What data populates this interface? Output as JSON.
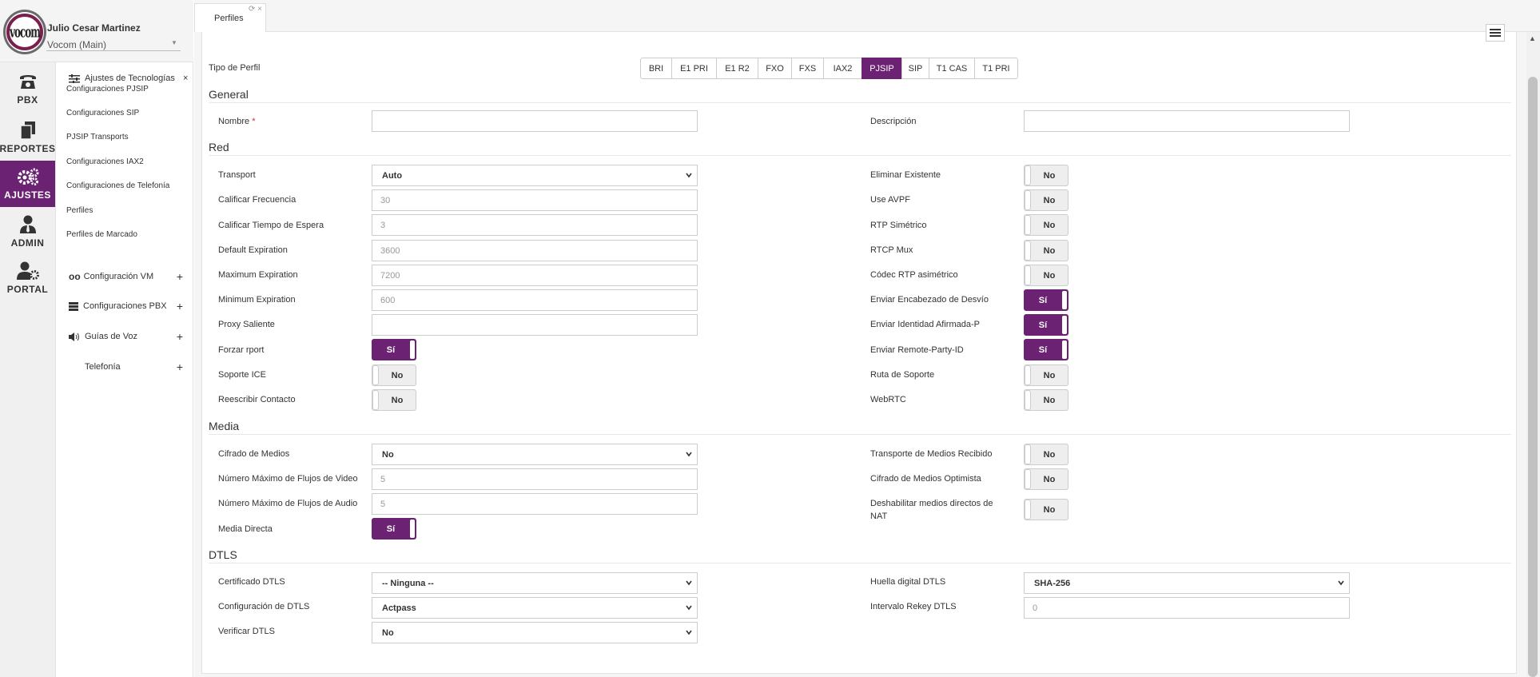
{
  "user": {
    "name": "Julio Cesar Martinez",
    "company": "Vocom (Main)",
    "logo_text": "vocom"
  },
  "rail": [
    {
      "label": "PBX",
      "icon": "phone-icon"
    },
    {
      "label": "REPORTES",
      "icon": "copy-icon"
    },
    {
      "label": "AJUSTES",
      "icon": "gears-icon",
      "active": true
    },
    {
      "label": "ADMIN",
      "icon": "user-tie-icon"
    },
    {
      "label": "PORTAL",
      "icon": "user-gear-icon"
    }
  ],
  "submenu": {
    "header": "Ajustes de Tecnologías",
    "close": "×",
    "links": [
      "Configuraciones PJSIP",
      "Configuraciones SIP",
      "PJSIP Transports",
      "Configuraciones IAX2",
      "Configuraciones de Telefonía",
      "Perfiles",
      "Perfiles de Marcado"
    ],
    "groups": [
      {
        "label": "Configuración VM",
        "icon": "voicemail-icon"
      },
      {
        "label": "Configuraciones PBX",
        "icon": "server-icon"
      },
      {
        "label": "Guías de Voz",
        "icon": "volume-icon"
      },
      {
        "label": "Telefonía",
        "icon": ""
      }
    ],
    "plus": "+"
  },
  "tab": {
    "label": "Perfiles",
    "icons": "⟳ ×"
  },
  "profile_type": {
    "label": "Tipo de Perfil",
    "options": [
      "BRI",
      "E1 PRI",
      "E1 R2",
      "FXO",
      "FXS",
      "IAX2",
      "PJSIP",
      "SIP",
      "T1 CAS",
      "T1 PRI"
    ],
    "selected": "PJSIP"
  },
  "sections": {
    "general": "General",
    "red": "Red",
    "media": "Media",
    "dtls": "DTLS"
  },
  "general": {
    "nombre_label": "Nombre",
    "required_mark": "*",
    "nombre_value": "",
    "descripcion_label": "Descripción",
    "descripcion_value": ""
  },
  "red": {
    "left": [
      {
        "label": "Transport",
        "type": "select",
        "value": "Auto"
      },
      {
        "label": "Calificar Frecuencia",
        "type": "input",
        "value": "30"
      },
      {
        "label": "Calificar Tiempo de Espera",
        "type": "input",
        "value": "3"
      },
      {
        "label": "Default Expiration",
        "type": "input",
        "value": "3600"
      },
      {
        "label": "Maximum Expiration",
        "type": "input",
        "value": "7200"
      },
      {
        "label": "Minimum Expiration",
        "type": "input",
        "value": "600"
      },
      {
        "label": "Proxy Saliente",
        "type": "input",
        "value": ""
      },
      {
        "label": "Forzar rport",
        "type": "toggle",
        "value": "Sí",
        "on": true
      },
      {
        "label": "Soporte ICE",
        "type": "toggle",
        "value": "No",
        "on": false
      },
      {
        "label": "Reescribir Contacto",
        "type": "toggle",
        "value": "No",
        "on": false
      }
    ],
    "right": [
      {
        "label": "Eliminar Existente",
        "value": "No",
        "on": false
      },
      {
        "label": "Use AVPF",
        "value": "No",
        "on": false
      },
      {
        "label": "RTP Simétrico",
        "value": "No",
        "on": false
      },
      {
        "label": "RTCP Mux",
        "value": "No",
        "on": false
      },
      {
        "label": "Códec RTP asimétrico",
        "value": "No",
        "on": false
      },
      {
        "label": "Enviar Encabezado de Desvío",
        "value": "Sí",
        "on": true
      },
      {
        "label": "Enviar Identidad Afirmada-P",
        "value": "Sí",
        "on": true
      },
      {
        "label": "Enviar Remote-Party-ID",
        "value": "Sí",
        "on": true
      },
      {
        "label": "Ruta de Soporte",
        "value": "No",
        "on": false
      },
      {
        "label": "WebRTC",
        "value": "No",
        "on": false
      }
    ]
  },
  "media": {
    "left": [
      {
        "label": "Cifrado de Medios",
        "type": "select",
        "value": "No"
      },
      {
        "label": "Número Máximo de Flujos de Video",
        "type": "input",
        "value": "5"
      },
      {
        "label": "Número Máximo de Flujos de Audio",
        "type": "input",
        "value": "5"
      },
      {
        "label": "Media Directa",
        "type": "toggle",
        "value": "Sí",
        "on": true
      }
    ],
    "right": [
      {
        "label": "Transporte de Medios Recibido",
        "value": "No",
        "on": false
      },
      {
        "label": "Cifrado de Medios Optimista",
        "value": "No",
        "on": false
      },
      {
        "label": "Deshabilitar medios directos de",
        "label2": "NAT",
        "value": "No",
        "on": false
      }
    ]
  },
  "dtls": {
    "left": [
      {
        "label": "Certificado DTLS",
        "type": "select",
        "value": "-- Ninguna --"
      },
      {
        "label": "Configuración de DTLS",
        "type": "select",
        "value": "Actpass"
      },
      {
        "label": "Verificar DTLS",
        "type": "select",
        "value": "No"
      }
    ],
    "right": [
      {
        "label": "Huella digital DTLS",
        "type": "select",
        "value": "SHA-256"
      },
      {
        "label": "Intervalo Rekey DTLS",
        "type": "input",
        "value": "0"
      }
    ]
  },
  "colors": {
    "accent": "#6b2272",
    "required": "#c0392b"
  }
}
